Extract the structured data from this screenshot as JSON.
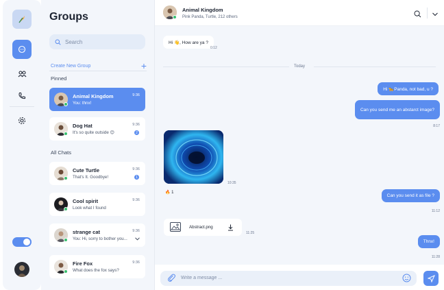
{
  "colors": {
    "accent": "#5b8def",
    "online": "#39c06f",
    "panel": "#f3f6fb"
  },
  "rail": {
    "logo_icon": "feather-logo-icon",
    "items": [
      {
        "name": "chat-icon",
        "active": true
      },
      {
        "name": "group-icon",
        "active": false
      },
      {
        "name": "phone-icon",
        "active": false
      },
      {
        "name": "settings-icon",
        "active": false
      }
    ]
  },
  "groups": {
    "title": "Groups",
    "search_placeholder": "Search",
    "create_label": "Create New Group",
    "create_plus": "+",
    "pinned_label": "Pinned",
    "all_chats_label": "All Chats",
    "pinned": [
      {
        "name": "Animal Kingdom",
        "preview": "You: thnx!",
        "time": "9:36",
        "active": true
      },
      {
        "name": "Dog Hat",
        "preview": "It's so quite outside 😊",
        "time": "9:36",
        "badge": "2"
      }
    ],
    "chats": [
      {
        "name": "Cute Turtle",
        "preview": "That's It. Goodbye!",
        "time": "9:36",
        "badge": "1"
      },
      {
        "name": "Cool spirit",
        "preview": "Look what I found",
        "time": "9:36"
      },
      {
        "name": "strange cat",
        "preview": "You: Hi, sorry to bother you...",
        "time": "9:36"
      },
      {
        "name": "Fire Fox",
        "preview": "What does the fox says?",
        "time": "9:36"
      }
    ]
  },
  "chat": {
    "title": "Animal Kingdom",
    "subtitle": "Pink Panda, Turtle, 212 others",
    "divider_label": "Today",
    "messages": {
      "m1": {
        "text": "Hi 👋, How are ya ?",
        "time": "0:12"
      },
      "m2": {
        "text": "Hi 🐆Panda, not bad, u ?"
      },
      "m3": {
        "text": "Can you send me an abstarct image?",
        "time": "8:17"
      },
      "m4": {
        "time": "10:35",
        "reaction": "🔥 1"
      },
      "m5": {
        "text": "Can you send it as file ?",
        "time": "11:12"
      },
      "m6": {
        "file_name": "Abstract.png",
        "time": "11:25"
      },
      "m7": {
        "text": "Thnx!",
        "time": "11:28"
      }
    },
    "composer_placeholder": "Write a message ..."
  }
}
